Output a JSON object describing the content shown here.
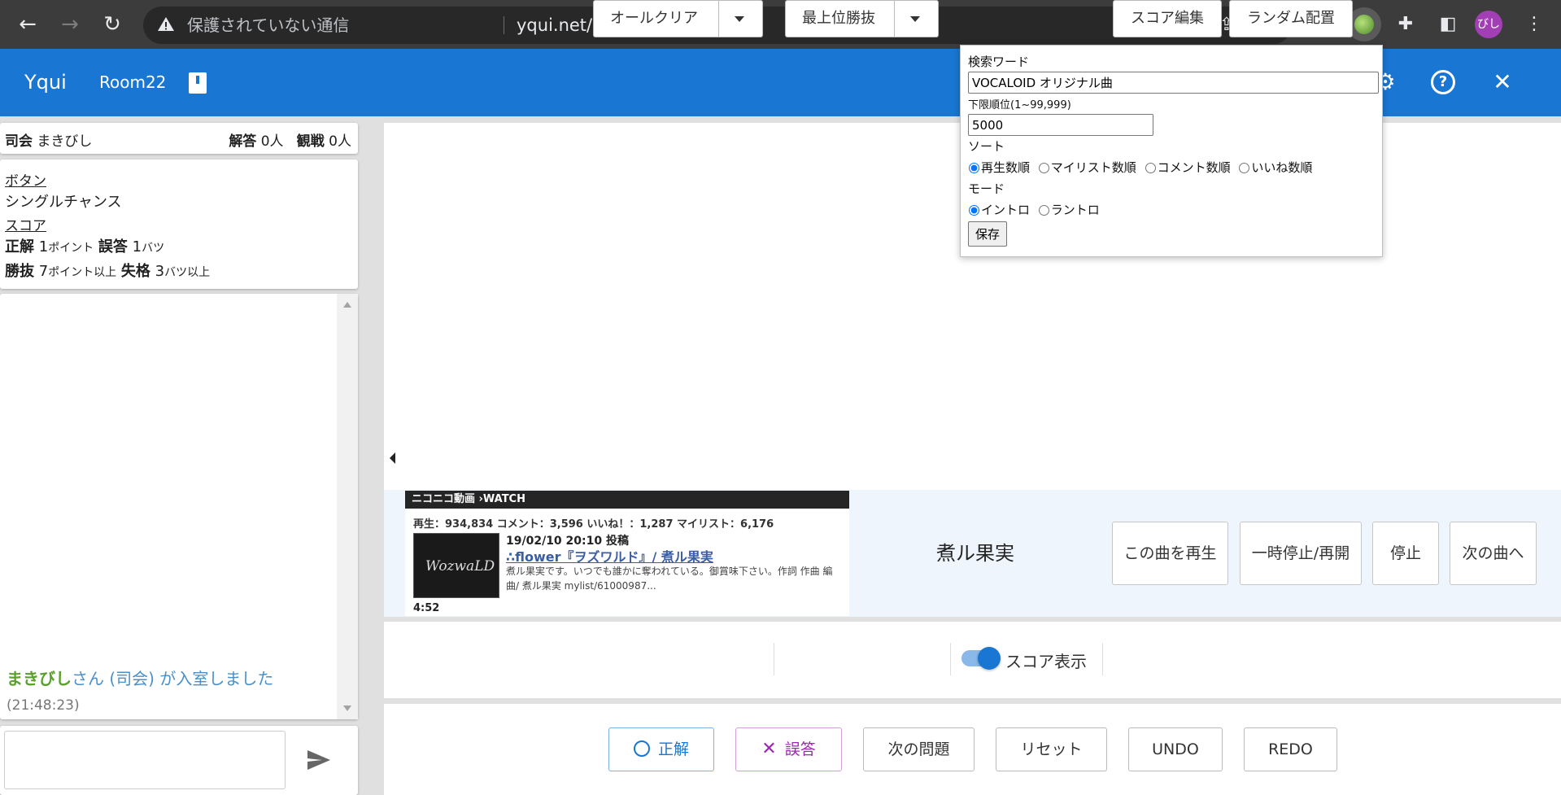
{
  "browser": {
    "security_text": "保護されていない通信",
    "url": "yqui.net/room/22",
    "avatar_text": "びし"
  },
  "appbar": {
    "brand": "Yqui",
    "room": "Room22"
  },
  "host_info": {
    "host_label": "司会",
    "host_name": "まきびし",
    "answer_label": "解答",
    "answer_count": "0人",
    "watch_label": "観戦",
    "watch_count": "0人"
  },
  "rules": {
    "button_heading": "ボタン",
    "button_mode": "シングルチャンス",
    "score_heading": "スコア",
    "correct_label": "正解",
    "correct_value": "1",
    "correct_unit": "ポイント",
    "wrong_label": "誤答",
    "wrong_value": "1",
    "wrong_unit": "バツ",
    "win_label": "勝抜",
    "win_value": "7",
    "win_unit": "ポイント以上",
    "lose_label": "失格",
    "lose_value": "3",
    "lose_unit": "バツ以上"
  },
  "chat": {
    "message_name": "まきびし",
    "message_text": "さん (司会) が入室しました",
    "message_time": "(21:48:23)",
    "input_placeholder": ""
  },
  "nico": {
    "header": "ニコニコ動画 ›WATCH",
    "stats": "再生：934,834 コメント：3,596 いいね！：1,287 マイリスト：6,176",
    "date": "19/02/10 20:10 投稿",
    "title": "∴flower『ヲズワルド』/ 煮ル果実",
    "description": "煮ル果実です。いつでも誰かに奪われている。御賞味下さい。作詞 作曲 編曲/ 煮ル果実 mylist/61000987...",
    "duration": "4:52",
    "thumb_text": "WozwaLD"
  },
  "player": {
    "artist": "煮ル果実",
    "play_label": "この曲を再生",
    "pause_label": "一時停止/再開",
    "stop_label": "停止",
    "next_label": "次の曲へ"
  },
  "controls": {
    "all_clear": "オールクリア",
    "top_win": "最上位勝抜",
    "score_display": "スコア表示",
    "score_edit": "スコア編集",
    "random_place": "ランダム配置",
    "score_display_on": true
  },
  "answer_bar": {
    "correct": "正解",
    "wrong": "誤答",
    "next_question": "次の問題",
    "reset": "リセット",
    "undo": "UNDO",
    "redo": "REDO"
  },
  "popup": {
    "search_label": "検索ワード",
    "search_value": "VOCALOID オリジナル曲",
    "min_rank_label": "下限順位(1~99,999)",
    "min_rank_value": "5000",
    "sort_label": "ソート",
    "sort_options": [
      "再生数順",
      "マイリスト数順",
      "コメント数順",
      "いいね数順"
    ],
    "sort_selected": "再生数順",
    "mode_label": "モード",
    "mode_options": [
      "イントロ",
      "ラントロ"
    ],
    "mode_selected": "イントロ",
    "save_label": "保存"
  },
  "colors": {
    "appbar": "#1976d2",
    "chat_name": "#5aa02c",
    "chat_text": "#4a90c9",
    "correct": "#1976d2",
    "wrong": "#9c27b0"
  }
}
